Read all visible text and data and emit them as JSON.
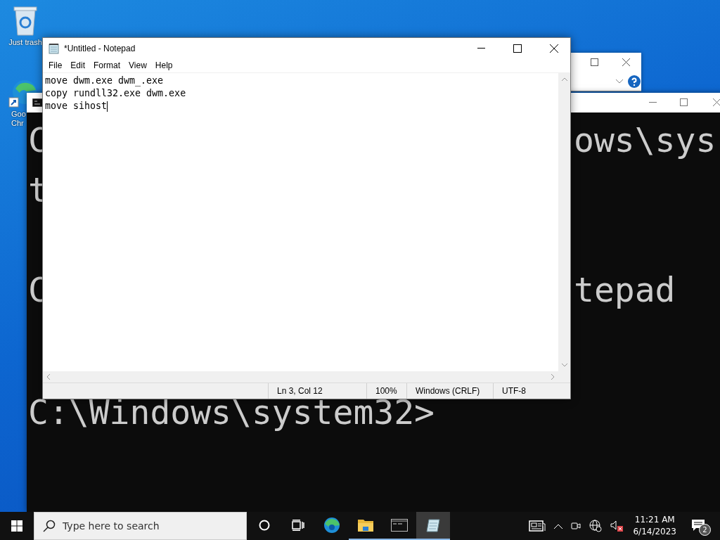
{
  "desktop_icons": [
    {
      "kind": "recycle-bin",
      "label_lines": [
        "Just trash"
      ]
    },
    {
      "kind": "browser-shortcut",
      "label_lines": [
        "Goo",
        "Chr"
      ]
    }
  ],
  "console": {
    "lines": [
      {
        "left": "C",
        "right": "ows\\sys"
      },
      {
        "left": "t"
      },
      {
        "left": "C",
        "right": "tepad"
      },
      {
        "left": "C:\\Windows\\system32>"
      }
    ]
  },
  "notepad": {
    "title": "*Untitled - Notepad",
    "menu": [
      "File",
      "Edit",
      "Format",
      "View",
      "Help"
    ],
    "lines": [
      "move dwm.exe dwm_.exe",
      "copy rundll32.exe dwm.exe",
      "move sihost"
    ],
    "status_bar": [
      "Ln 3, Col 12",
      "100%",
      "Windows (CRLF)",
      "UTF-8"
    ]
  },
  "taskbar": {
    "search": {
      "placeholder": "Type here to search"
    },
    "apps": [
      {
        "kind": "cortana",
        "running": false,
        "selected": false
      },
      {
        "kind": "task-view",
        "running": false,
        "selected": false
      },
      {
        "kind": "edge",
        "running": false,
        "selected": false
      },
      {
        "kind": "explorer",
        "running": true,
        "selected": false
      },
      {
        "kind": "terminal",
        "running": true,
        "selected": false
      },
      {
        "kind": "notepad",
        "running": true,
        "selected": true
      }
    ],
    "time": "11:21 AM",
    "date": "6/14/2023",
    "notification_count": "2"
  }
}
